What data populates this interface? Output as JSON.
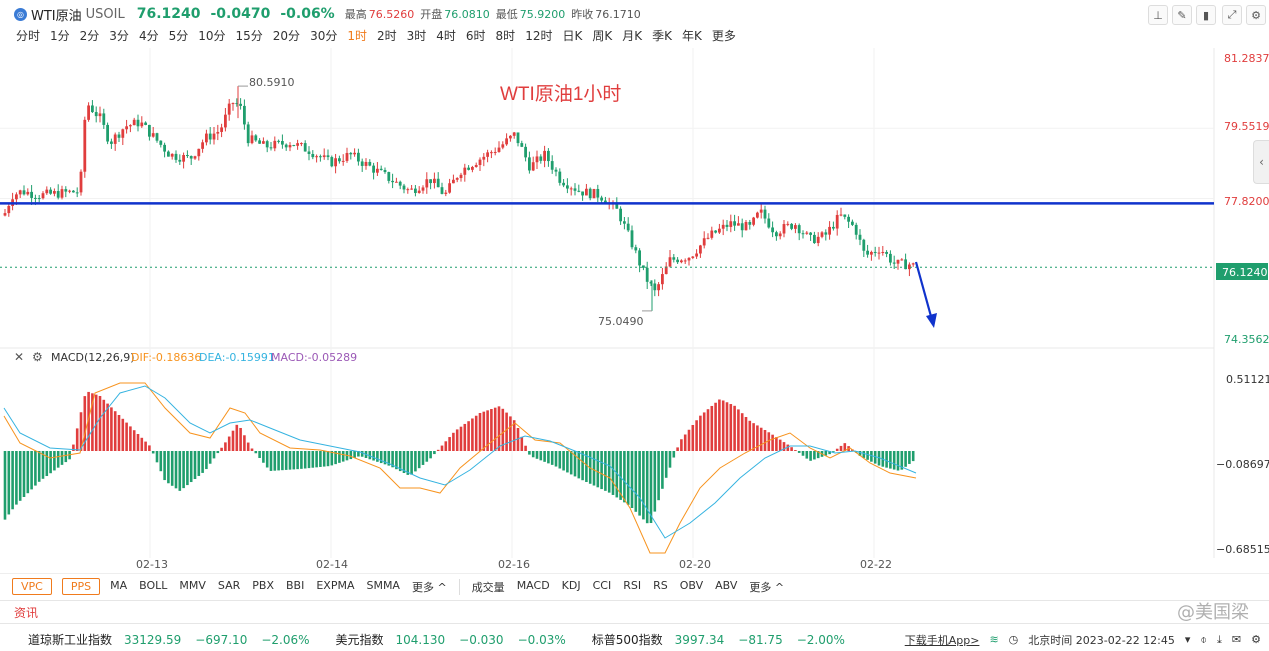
{
  "header": {
    "logo_icon": "oil-logo-icon",
    "name": "WTI原油",
    "symbol": "USOIL",
    "price": "76.1240",
    "change": "-0.0470",
    "change_pct": "-0.06%",
    "high_label": "最高",
    "high_value": "76.5260",
    "open_label": "开盘",
    "open_value": "76.0810",
    "low_label": "最低",
    "low_value": "75.9200",
    "prev_label": "昨收",
    "prev_value": "76.1710"
  },
  "toolbar": {
    "icons": [
      "baseline-icon",
      "pen-icon",
      "candlestick-icon",
      "expand-icon",
      "settings-icon"
    ]
  },
  "periods": [
    {
      "label": "分时"
    },
    {
      "label": "1分"
    },
    {
      "label": "2分"
    },
    {
      "label": "3分"
    },
    {
      "label": "4分"
    },
    {
      "label": "5分"
    },
    {
      "label": "10分"
    },
    {
      "label": "15分"
    },
    {
      "label": "20分"
    },
    {
      "label": "30分"
    },
    {
      "label": "1时",
      "active": true
    },
    {
      "label": "2时"
    },
    {
      "label": "3时"
    },
    {
      "label": "4时"
    },
    {
      "label": "6时"
    },
    {
      "label": "8时"
    },
    {
      "label": "12时"
    },
    {
      "label": "日K"
    },
    {
      "label": "周K"
    },
    {
      "label": "月K"
    },
    {
      "label": "季K"
    },
    {
      "label": "年K"
    },
    {
      "label": "更多"
    }
  ],
  "chart": {
    "annotation": "WTI原油1小时",
    "max_label": "80.5910",
    "min_label": "75.0490",
    "price_ticks": [
      "81.2837",
      "79.5519",
      "77.8200",
      "74.3562"
    ],
    "current_price": "76.1240",
    "resistance_level": 77.7,
    "date_ticks": [
      "02-13",
      "02-14",
      "02-16",
      "02-20",
      "02-22"
    ],
    "macd_title": "MACD(12,26,9)",
    "dif": "DIF:-0.18636",
    "dea": "DEA:-0.15991",
    "macd": "MACD:-0.05289",
    "macd_ticks": [
      "0.51121",
      "−0.08697",
      "−0.68515"
    ],
    "colors": {
      "up": "#e03d3d",
      "down": "#1f9e6d",
      "line_blue": "#1033cc",
      "dif": "#f7931e",
      "dea": "#35b3e0",
      "macd_purple": "#9b59b6"
    }
  },
  "chart_data": {
    "type": "candlestick",
    "ylim": [
      74.3562,
      81.2837
    ],
    "labels": {
      "max": 80.591,
      "min": 75.049,
      "last": 76.124
    },
    "x": [
      "02-13",
      "02-14",
      "02-16",
      "02-20",
      "02-22"
    ]
  },
  "bottom": {
    "vpc": "VPC",
    "pps": "PPS",
    "main_inds": [
      "MA",
      "BOLL",
      "MMV",
      "SAR",
      "PBX",
      "BBI",
      "EXPMA",
      "SMMA",
      "更多 ^"
    ],
    "sub_inds": [
      "成交量",
      "MACD",
      "KDJ",
      "CCI",
      "RSI",
      "RS",
      "OBV",
      "ABV",
      "更多 ^"
    ]
  },
  "news": {
    "label": "资讯"
  },
  "watermark": "@美国梁",
  "ticker": [
    {
      "name": "道琼斯工业指数",
      "price": "33129.59",
      "chg": "−697.10",
      "pct": "−2.06%"
    },
    {
      "name": "美元指数",
      "price": "104.130",
      "chg": "−0.030",
      "pct": "−0.03%"
    },
    {
      "name": "标普500指数",
      "price": "3997.34",
      "chg": "−81.75",
      "pct": "−2.00%"
    }
  ],
  "status": {
    "download": "下载手机App>",
    "time": "北京时间 2023-02-22 12:45"
  }
}
